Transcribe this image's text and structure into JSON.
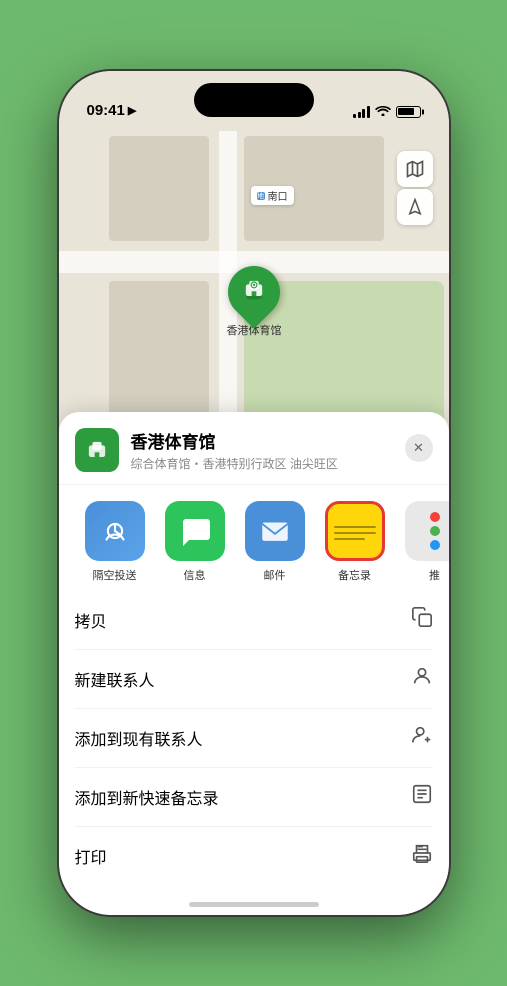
{
  "statusBar": {
    "time": "09:41",
    "locationIcon": "▶"
  },
  "map": {
    "label": "南口",
    "pinLabel": "香港体育馆"
  },
  "controls": {
    "mapIcon": "🗺",
    "locationIcon": "➤"
  },
  "sheet": {
    "venueName": "香港体育馆",
    "venueSub": "综合体育馆・香港特别行政区 油尖旺区",
    "closeLabel": "✕"
  },
  "shareItems": [
    {
      "id": "airdrop",
      "label": "隔空投送"
    },
    {
      "id": "messages",
      "label": "信息"
    },
    {
      "id": "mail",
      "label": "邮件"
    },
    {
      "id": "notes",
      "label": "备忘录"
    },
    {
      "id": "more",
      "label": "推"
    }
  ],
  "actions": [
    {
      "label": "拷贝",
      "icon": "copy"
    },
    {
      "label": "新建联系人",
      "icon": "person"
    },
    {
      "label": "添加到现有联系人",
      "icon": "person-add"
    },
    {
      "label": "添加到新快速备忘录",
      "icon": "note"
    },
    {
      "label": "打印",
      "icon": "print"
    }
  ]
}
